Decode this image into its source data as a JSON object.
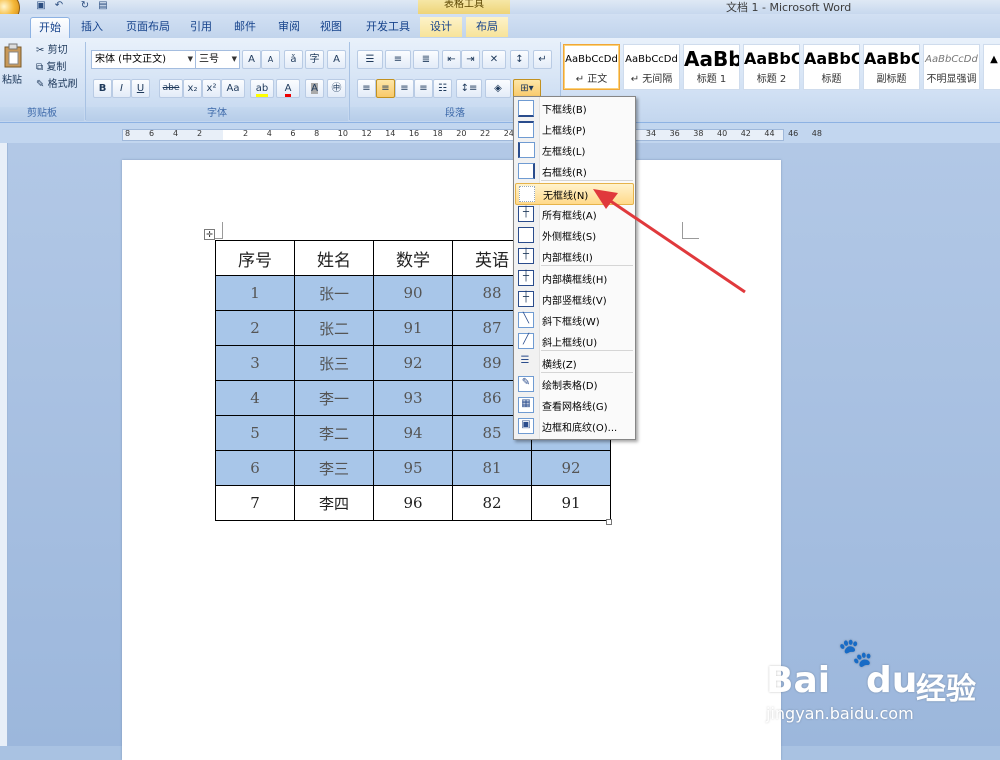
{
  "window": {
    "app_title": "文档 1 - Microsoft Word",
    "context_tab_title": "表格工具"
  },
  "tabs": [
    {
      "label": "开始",
      "active": true
    },
    {
      "label": "插入"
    },
    {
      "label": "页面布局"
    },
    {
      "label": "引用"
    },
    {
      "label": "邮件"
    },
    {
      "label": "审阅"
    },
    {
      "label": "视图"
    },
    {
      "label": "开发工具"
    },
    {
      "label": "设计",
      "context": true
    },
    {
      "label": "布局",
      "context": true
    }
  ],
  "clipboard": {
    "paste_label": "粘贴",
    "cut_label": "剪切",
    "copy_label": "复制",
    "format_painter_label": "格式刷",
    "group_label": "剪贴板"
  },
  "font": {
    "font_name": "宋体 (中文正文)",
    "font_size": "三号",
    "grow": "A",
    "shrink": "A",
    "bold": "B",
    "italic": "I",
    "underline": "U",
    "strike": "abe",
    "subscript": "x₂",
    "superscript": "x²",
    "case": "Aa",
    "group_label": "字体"
  },
  "paragraph": {
    "group_label": "段落"
  },
  "styles": [
    {
      "sample": "AaBbCcDd",
      "name": "↵ 正文",
      "selected": true
    },
    {
      "sample": "AaBbCcDd",
      "name": "↵ 无间隔"
    },
    {
      "sample": "AaBb",
      "name": "标题 1"
    },
    {
      "sample": "AaBbC",
      "name": "标题 2"
    },
    {
      "sample": "AaBbC",
      "name": "标题"
    },
    {
      "sample": "AaBbC",
      "name": "副标题"
    },
    {
      "sample": "AaBbCcDd",
      "name": "不明显强调"
    }
  ],
  "ruler": {
    "left_numbers": [
      "8",
      "6",
      "4",
      "2"
    ],
    "right_numbers": [
      "2",
      "4",
      "6",
      "8",
      "10",
      "12",
      "14",
      "16",
      "18",
      "20",
      "22",
      "24",
      "",
      "",
      "",
      "",
      "",
      "34",
      "36",
      "38",
      "40",
      "42",
      "44",
      "46",
      "48"
    ]
  },
  "table": {
    "header": [
      "序号",
      "姓名",
      "数学",
      "英语",
      ""
    ],
    "rows": [
      [
        "1",
        "张一",
        "90",
        "88",
        ""
      ],
      [
        "2",
        "张二",
        "91",
        "87",
        ""
      ],
      [
        "3",
        "张三",
        "92",
        "89",
        ""
      ],
      [
        "4",
        "李一",
        "93",
        "86",
        ""
      ],
      [
        "5",
        "李二",
        "94",
        "85",
        ""
      ],
      [
        "6",
        "李三",
        "95",
        "81",
        "92"
      ],
      [
        "7",
        "李四",
        "96",
        "82",
        "91"
      ]
    ]
  },
  "border_menu": {
    "items": [
      {
        "label": "下框线(B)"
      },
      {
        "label": "上框线(P)"
      },
      {
        "label": "左框线(L)"
      },
      {
        "label": "右框线(R)"
      },
      {
        "label": "无框线(N)",
        "highlighted": true
      },
      {
        "label": "所有框线(A)"
      },
      {
        "label": "外侧框线(S)"
      },
      {
        "label": "内部框线(I)"
      },
      {
        "label": "内部横框线(H)"
      },
      {
        "label": "内部竖框线(V)"
      },
      {
        "label": "斜下框线(W)"
      },
      {
        "label": "斜上框线(U)"
      },
      {
        "label": "横线(Z)"
      },
      {
        "label": "绘制表格(D)"
      },
      {
        "label": "查看网格线(G)"
      },
      {
        "label": "边框和底纹(O)..."
      }
    ]
  },
  "watermark": {
    "brand": "Bai",
    "brand2": "du",
    "suffix": "经验",
    "url": "jingyan.baidu.com"
  },
  "colors": {
    "selection": "#a8c6e9",
    "arrow": "#e0393c",
    "menu_highlight": "#ffd98a"
  }
}
